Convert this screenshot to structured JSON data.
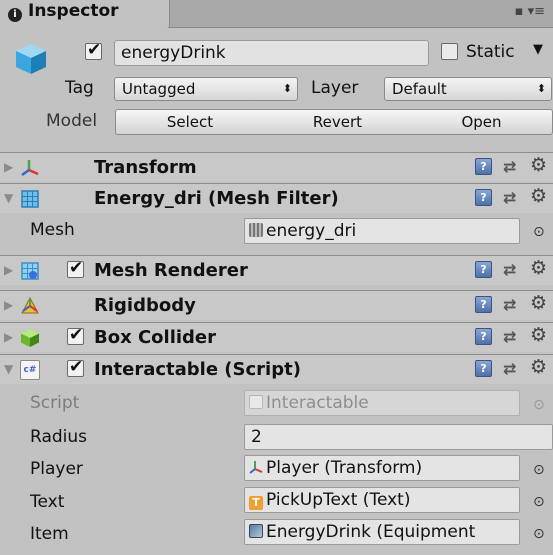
{
  "window": {
    "tab_title": "Inspector"
  },
  "game_object": {
    "active": true,
    "name": "energyDrink",
    "static_label": "Static",
    "static_checked": false,
    "tag_label": "Tag",
    "tag_value": "Untagged",
    "layer_label": "Layer",
    "layer_value": "Default",
    "model_label": "Model",
    "model_buttons": [
      "Select",
      "Revert",
      "Open"
    ]
  },
  "components": [
    {
      "title": "Transform",
      "expanded": false,
      "icon": "transform-icon"
    },
    {
      "title": "Energy_dri (Mesh Filter)",
      "expanded": true,
      "icon": "mesh-filter-icon",
      "fields": [
        {
          "label": "Mesh",
          "value": "energy_dri"
        }
      ]
    },
    {
      "title": "Mesh Renderer",
      "expanded": false,
      "enabled": true,
      "icon": "mesh-renderer-icon"
    },
    {
      "title": "Rigidbody",
      "expanded": false,
      "icon": "rigidbody-icon"
    },
    {
      "title": "Box Collider",
      "expanded": false,
      "enabled": true,
      "icon": "box-collider-icon"
    },
    {
      "title": "Interactable (Script)",
      "expanded": true,
      "enabled": true,
      "icon": "script-icon",
      "fields": [
        {
          "label": "Script",
          "value": "Interactable"
        },
        {
          "label": "Radius",
          "value": "2"
        },
        {
          "label": "Player",
          "value": "Player (Transform)"
        },
        {
          "label": "Text",
          "value": "PickUpText (Text)"
        },
        {
          "label": "Item",
          "value": "EnergyDrink (Equipment"
        }
      ]
    }
  ],
  "icons": {
    "help": "?",
    "gear": "⚙",
    "preset": "⇄",
    "picker": "⊙",
    "script_glyph": "c#",
    "text_glyph": "T"
  }
}
